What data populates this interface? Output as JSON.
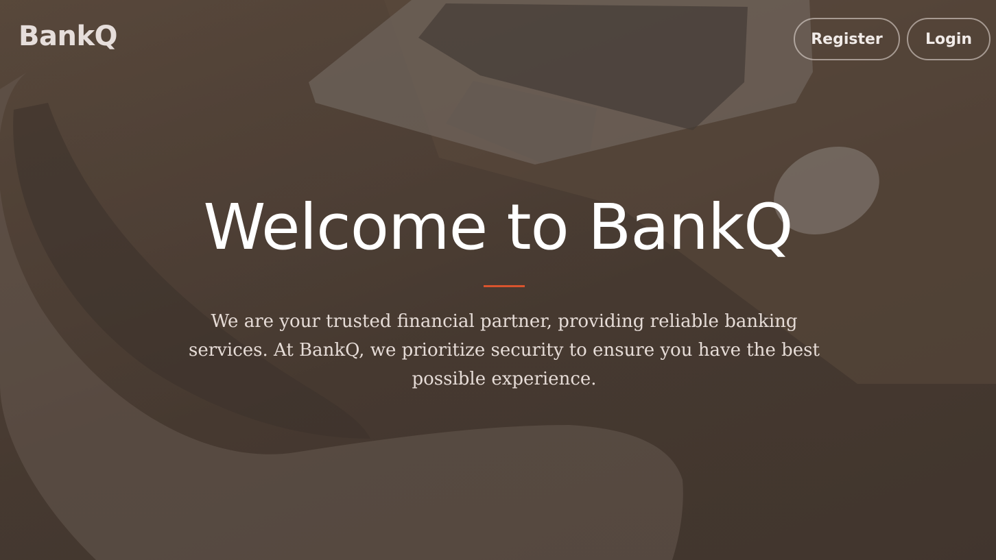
{
  "header": {
    "brand": "BankQ",
    "nav": {
      "register_label": "Register",
      "login_label": "Login"
    }
  },
  "hero": {
    "title": "Welcome to BankQ",
    "description": "We are your trusted financial partner, providing reliable banking services. At BankQ, we prioritize security to ensure you have the best possible experience."
  },
  "colors": {
    "accent": "#d9542d",
    "overlay": "#4b3f37",
    "text": "#ffffff"
  }
}
